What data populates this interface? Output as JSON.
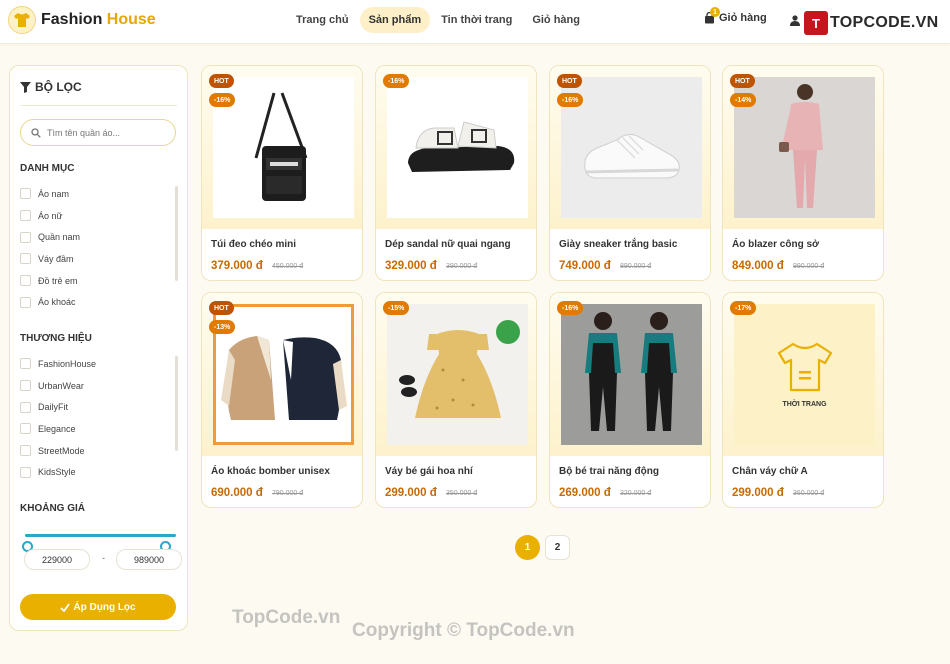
{
  "brand": {
    "name_part1": "Fashion",
    "name_part2": "House"
  },
  "nav": [
    "Trang chủ",
    "Sản phẩm",
    "Tin thời trang",
    "Giỏ hàng"
  ],
  "cart": {
    "label": "Giỏ hàng",
    "count": "1"
  },
  "watermark_logo": {
    "box": "T",
    "text": "TOPCODE.VN"
  },
  "filter": {
    "title": "BỘ LỌC",
    "search_placeholder": "Tìm tên quần áo...",
    "category_heading": "DANH MỤC",
    "categories": [
      "Áo nam",
      "Áo nữ",
      "Quần nam",
      "Váy đầm",
      "Đồ trẻ em",
      "Áo khoác"
    ],
    "brand_heading": "THƯƠNG HIỆU",
    "brands": [
      "FashionHouse",
      "UrbanWear",
      "DailyFit",
      "Elegance",
      "StreetMode",
      "KidsStyle"
    ],
    "price_heading": "KHOẢNG GIÁ",
    "price_min": "229000",
    "price_sep": "-",
    "price_max": "989000",
    "apply_label": "Áp Dụng Lọc"
  },
  "products": [
    {
      "name": "Túi đeo chéo mini",
      "price": "379.000 đ",
      "old_price": "450.000 đ",
      "hot": "HOT",
      "discount": "-16%",
      "image": "crossbody-bag"
    },
    {
      "name": "Dép sandal nữ quai ngang",
      "price": "329.000 đ",
      "old_price": "390.000 đ",
      "hot": "",
      "discount": "-16%",
      "image": "sandal"
    },
    {
      "name": "Giày sneaker trắng basic",
      "price": "749.000 đ",
      "old_price": "890.000 đ",
      "hot": "HOT",
      "discount": "-16%",
      "image": "sneaker"
    },
    {
      "name": "Áo blazer công sở",
      "price": "849.000 đ",
      "old_price": "990.000 đ",
      "hot": "HOT",
      "discount": "-14%",
      "image": "blazer"
    },
    {
      "name": "Áo khoác bomber unisex",
      "price": "690.000 đ",
      "old_price": "790.000 đ",
      "hot": "HOT",
      "discount": "-13%",
      "image": "bomber"
    },
    {
      "name": "Váy bé gái hoa nhí",
      "price": "299.000 đ",
      "old_price": "350.000 đ",
      "hot": "",
      "discount": "-15%",
      "image": "girl-dress"
    },
    {
      "name": "Bộ bé trai năng động",
      "price": "269.000 đ",
      "old_price": "320.000 đ",
      "hot": "",
      "discount": "-16%",
      "image": "boys-set"
    },
    {
      "name": "Chân váy chữ A",
      "price": "299.000 đ",
      "old_price": "360.000 đ",
      "hot": "",
      "discount": "-17%",
      "image": "placeholder",
      "placeholder_text": "THỜI TRANG"
    }
  ],
  "pagination": [
    "1",
    "2"
  ],
  "watermarks": {
    "top": "TopCode.vn",
    "bottom": "Copyright © TopCode.vn"
  },
  "colors": {
    "accent": "#e9b000",
    "hot": "#bf5400",
    "discount": "#e07a00",
    "price": "#c96a00"
  }
}
